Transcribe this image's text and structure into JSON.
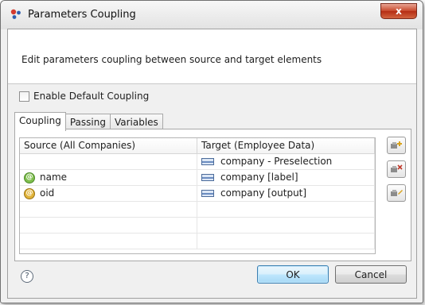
{
  "window": {
    "title": "Parameters Coupling",
    "close_label": "x"
  },
  "banner": {
    "description": "Edit parameters coupling between source and target elements"
  },
  "enable_default": {
    "label": "Enable Default Coupling",
    "checked": false
  },
  "tabs": [
    {
      "label": "Coupling",
      "active": true
    },
    {
      "label": "Passing",
      "active": false
    },
    {
      "label": "Variables",
      "active": false
    }
  ],
  "table": {
    "columns": [
      "Source (All Companies)",
      "Target (Employee Data)"
    ],
    "rows": [
      {
        "source": "",
        "source_icon": "",
        "target": "company - Preselection",
        "target_icon": "structure-icon"
      },
      {
        "source": "name",
        "source_icon": "attribute-icon",
        "target": "company [label]",
        "target_icon": "structure-icon"
      },
      {
        "source": "oid",
        "source_icon": "key-attribute-icon",
        "target": "company [output]",
        "target_icon": "structure-icon"
      }
    ]
  },
  "side_buttons": [
    "add-coupling-icon",
    "delete-coupling-icon",
    "edit-coupling-icon"
  ],
  "footer": {
    "help_symbol": "?",
    "ok_label": "OK",
    "cancel_label": "Cancel"
  },
  "colors": {
    "close_button": "#c7472a",
    "default_button_border": "#3c7fb1",
    "target_icon": "#6b8cc0"
  }
}
